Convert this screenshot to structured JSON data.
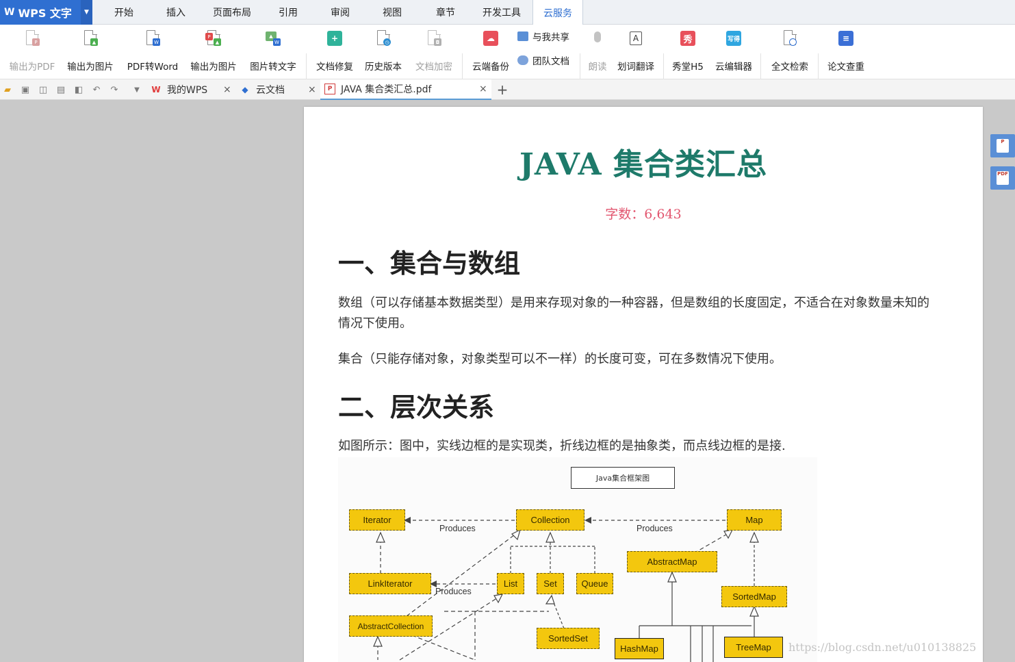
{
  "app": {
    "name": "WPS 文字"
  },
  "menu": {
    "tabs": [
      "开始",
      "插入",
      "页面布局",
      "引用",
      "审阅",
      "视图",
      "章节",
      "开发工具",
      "云服务"
    ],
    "active": "云服务"
  },
  "ribbon": {
    "export_pdf": "输出为PDF",
    "export_image": "输出为图片",
    "pdf_to_word": "PDF转Word",
    "export_image2": "输出为图片",
    "image_to_text": "图片转文字",
    "doc_repair": "文档修复",
    "history": "历史版本",
    "doc_encrypt": "文档加密",
    "cloud_backup": "云端备份",
    "shared_with_me": "与我共享",
    "team_docs": "团队文档",
    "read_aloud": "朗读",
    "word_translate": "划词翻译",
    "xiutang_h5": "秀堂H5",
    "cloud_editor": "云编辑器",
    "fulltext_search": "全文检索",
    "thesis_check": "论文查重",
    "icon_xiu": "秀",
    "icon_xiede": "写得"
  },
  "doc_tabs": [
    {
      "label": "我的WPS",
      "icon": "wps-icon"
    },
    {
      "label": "云文档",
      "icon": "cloud-doc-icon"
    },
    {
      "label": "JAVA 集合类汇总.pdf",
      "icon": "pdf-icon"
    }
  ],
  "document": {
    "title": "JAVA 集合类汇总",
    "word_count": "字数：6,643",
    "h1_a": "一、集合与数组",
    "p1": "数组（可以存储基本数据类型）是用来存现对象的一种容器，但是数组的长度固定，不适合在对象数量未知的情况下使用。",
    "p2": "集合（只能存储对象，对象类型可以不一样）的长度可变，可在多数情况下使用。",
    "h1_b": "二、层次关系",
    "p3": "如图所示：图中，实线边框的是实现类，折线边框的是抽象类，而点线边框的是接.",
    "watermark": "https://blog.csdn.net/u010138825"
  },
  "figure": {
    "title": "Java集合框架图",
    "nodes": {
      "iterator": "Iterator",
      "collection": "Collection",
      "map": "Map",
      "linkiterator": "LinkIterator",
      "list": "List",
      "set": "Set",
      "queue": "Queue",
      "abstractmap": "AbstractMap",
      "sortedmap": "SortedMap",
      "abstractcollection": "AbstractCollection",
      "sortedset": "SortedSet",
      "hashmap": "HashMap",
      "treemap": "TreeMap"
    },
    "labels": {
      "produces1": "Produces",
      "produces2": "Produces",
      "produces3": "Produces"
    }
  }
}
